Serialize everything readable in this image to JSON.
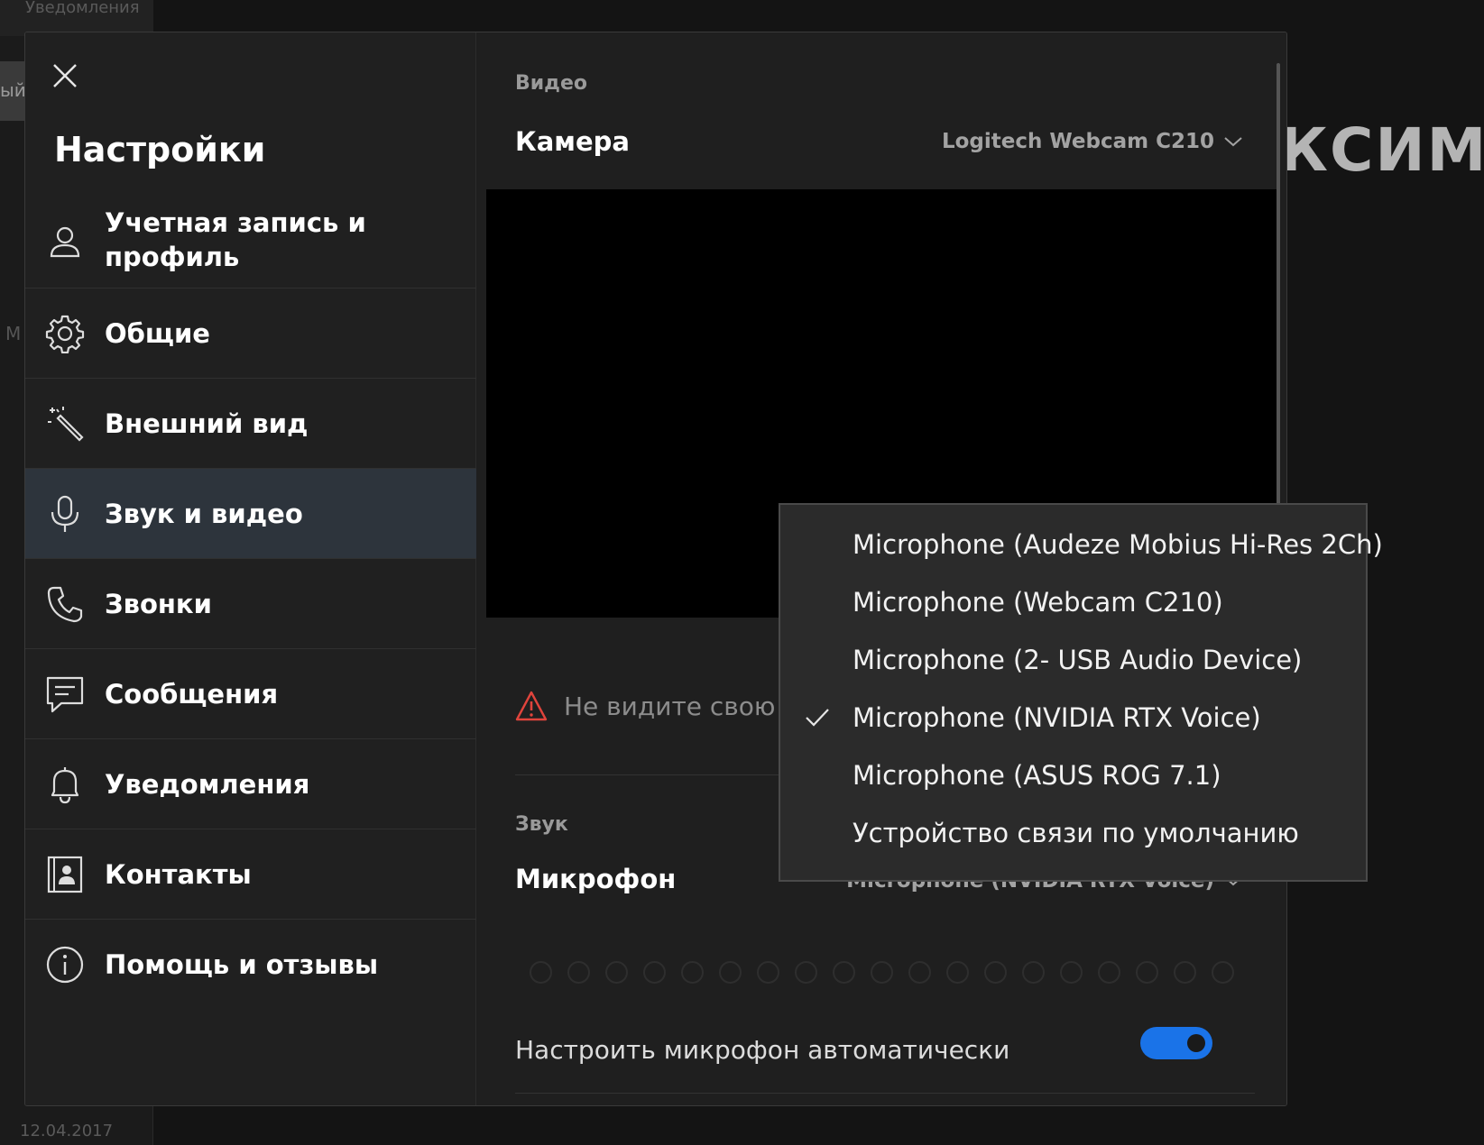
{
  "background": {
    "tab_label": "Уведомления",
    "chip_text": "ый",
    "big_text": "КСИМ",
    "side_letter": "М",
    "bottom_date": "12.04.2017"
  },
  "dialog": {
    "title": "Настройки",
    "menu": [
      {
        "label": "Учетная запись и профиль",
        "icon": "person-icon"
      },
      {
        "label": "Общие",
        "icon": "gear-icon"
      },
      {
        "label": "Внешний вид",
        "icon": "magic-wand-icon"
      },
      {
        "label": "Звук и видео",
        "icon": "microphone-icon",
        "active": true
      },
      {
        "label": "Звонки",
        "icon": "phone-icon"
      },
      {
        "label": "Сообщения",
        "icon": "message-icon"
      },
      {
        "label": "Уведомления",
        "icon": "bell-icon"
      },
      {
        "label": "Контакты",
        "icon": "contact-card-icon"
      },
      {
        "label": "Помощь и отзывы",
        "icon": "info-icon"
      }
    ]
  },
  "video": {
    "section_label": "Видео",
    "camera_label": "Камера",
    "camera_value": "Logitech Webcam C210",
    "warning_text": "Не видите свою к"
  },
  "audio": {
    "section_label": "Звук",
    "mic_label": "Микрофон",
    "mic_value": "Microphone (NVIDIA RTX Voice)",
    "auto_label": "Настроить микрофон автоматически",
    "auto_enabled": true,
    "level_dots": 19
  },
  "dropdown": {
    "options": [
      {
        "label": "Microphone (Audeze Mobius Hi-Res 2Ch)",
        "selected": false
      },
      {
        "label": "Microphone (Webcam C210)",
        "selected": false
      },
      {
        "label": "Microphone (2- USB Audio Device)",
        "selected": false
      },
      {
        "label": "Microphone (NVIDIA RTX Voice)",
        "selected": true
      },
      {
        "label": "Microphone (ASUS ROG 7.1)",
        "selected": false
      },
      {
        "label": "Устройство связи по умолчанию",
        "selected": false
      }
    ]
  },
  "colors": {
    "accent": "#1a73e8",
    "warning": "#e0443c",
    "active_bg": "#2d343c"
  }
}
